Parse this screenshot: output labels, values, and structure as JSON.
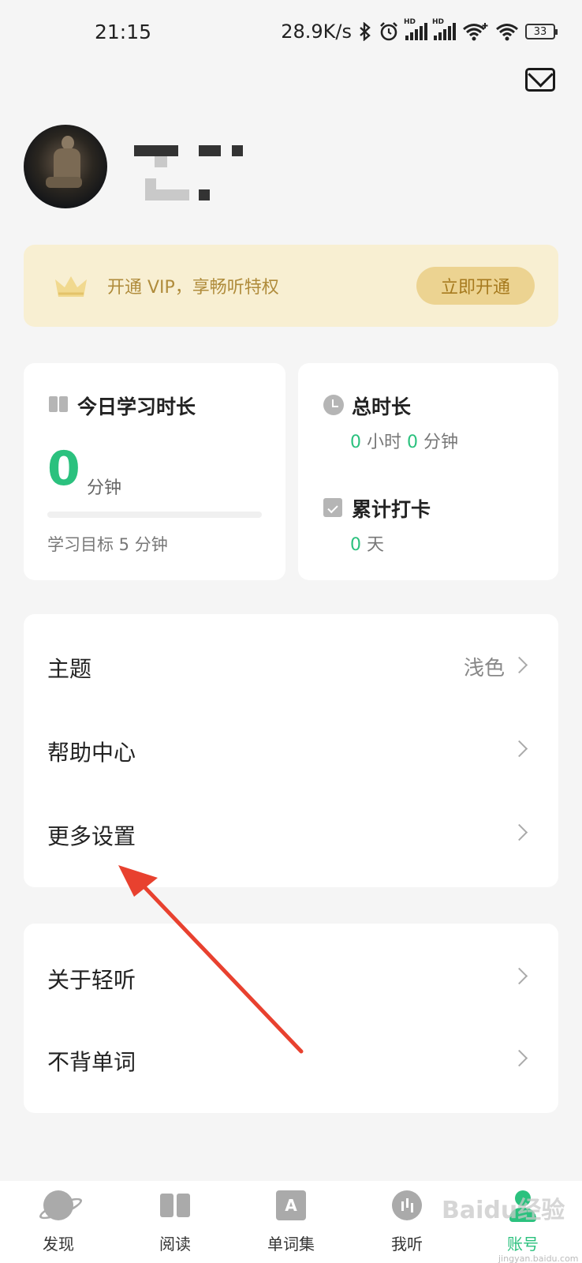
{
  "status_bar": {
    "time": "21:15",
    "network_speed": "28.9K/s",
    "battery": "33",
    "hd_label": "HD"
  },
  "profile": {
    "avatar": "terracotta-warrior-photo"
  },
  "vip": {
    "text": "开通 VIP，享畅听特权",
    "button": "立即开通"
  },
  "today": {
    "title": "今日学习时长",
    "value": "0",
    "unit": "分钟",
    "goal": "学习目标 5 分钟",
    "progress": 0
  },
  "total": {
    "title": "总时长",
    "hours": "0",
    "hours_unit": "小时",
    "minutes": "0",
    "minutes_unit": "分钟",
    "checkin_title": "累计打卡",
    "days": "0",
    "days_unit": "天"
  },
  "menu1": [
    {
      "label": "主题",
      "value": "浅色"
    },
    {
      "label": "帮助中心",
      "value": ""
    },
    {
      "label": "更多设置",
      "value": ""
    }
  ],
  "menu2": [
    {
      "label": "关于轻听",
      "value": ""
    },
    {
      "label": "不背单词",
      "value": ""
    }
  ],
  "tabbar": [
    {
      "label": "发现",
      "icon": "planet-icon"
    },
    {
      "label": "阅读",
      "icon": "book-icon"
    },
    {
      "label": "单词集",
      "icon": "word-set-icon"
    },
    {
      "label": "我听",
      "icon": "listen-icon"
    },
    {
      "label": "账号",
      "icon": "account-icon"
    }
  ],
  "word_icon_letter": "A",
  "watermark": {
    "brand": "Baidu经验",
    "url": "jingyan.baidu.com"
  },
  "colors": {
    "accent_green": "#2bc17e",
    "vip_bg": "#f8efd2",
    "vip_text": "#b08c3c",
    "annotation_arrow": "#e8412f"
  }
}
